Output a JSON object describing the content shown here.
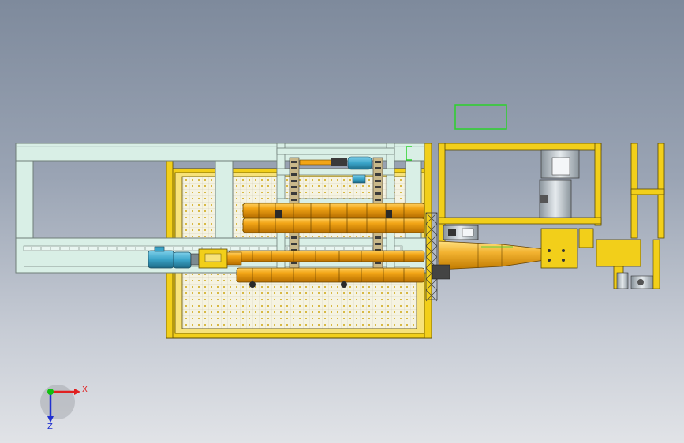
{
  "viewport": {
    "background_top": "#7e8a9c",
    "background_bottom": "#e1e3e7"
  },
  "colors": {
    "frame_yellow": "#f2cf1a",
    "frame_outline": "#5a4a00",
    "light_cyan_frame": "#d9efe6",
    "frame_edge": "#6f7d78",
    "orange_cylinder": "#f2a516",
    "orange_highlight": "#ffd060",
    "blue_motor": "#3aa4c8",
    "mesh_dot": "#e8c21a",
    "selection_green": "#2bd22b",
    "dark_part": "#3a3a3a",
    "grey_machine": "#b8c1c9"
  },
  "triad": {
    "x_label": "X",
    "z_label": "Z",
    "x_color": "#e02020",
    "z_color": "#2030d0",
    "origin_color": "#10c010"
  }
}
